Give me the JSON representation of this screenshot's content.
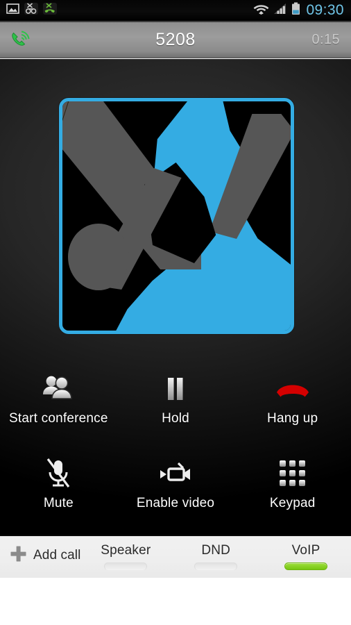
{
  "status_bar": {
    "left_icons": [
      {
        "name": "screenshot-image-icon",
        "label": "Screenshot saved"
      },
      {
        "name": "voicemail-unavailable-icon",
        "label": "Voicemail"
      },
      {
        "name": "missed-call-icon",
        "label": "Missed call"
      }
    ],
    "right_icons": [
      {
        "name": "wifi-icon",
        "label": "Wi-Fi"
      },
      {
        "name": "cellular-signal-icon",
        "label": "Signal"
      },
      {
        "name": "battery-icon",
        "label": "Battery"
      }
    ],
    "clock": "09:30",
    "clock_color": "#6fc5e8"
  },
  "title_bar": {
    "call_state_icon": "active-call-icon",
    "number": "5208",
    "duration": "0:15"
  },
  "avatar": {
    "name": "contact-photo",
    "accent_color": "#34ACE3",
    "border_color": "#34ACE3"
  },
  "controls": {
    "rows": [
      [
        {
          "icon": "conference-people-icon",
          "label": "Start conference",
          "name": "start-conference-button"
        },
        {
          "icon": "pause-icon",
          "label": "Hold",
          "name": "hold-button"
        },
        {
          "icon": "hang-up-handset-icon",
          "label": "Hang up",
          "name": "hang-up-button"
        }
      ],
      [
        {
          "icon": "microphone-muted-icon",
          "label": "Mute",
          "name": "mute-button"
        },
        {
          "icon": "video-camera-icon",
          "label": "Enable video",
          "name": "enable-video-button"
        },
        {
          "icon": "keypad-grid-icon",
          "label": "Keypad",
          "name": "keypad-button"
        }
      ]
    ],
    "hang_up_color": "#d40000"
  },
  "bottom_bar": {
    "add_call": {
      "icon": "plus-icon",
      "label": "Add call"
    },
    "toggles": [
      {
        "label": "Speaker",
        "state": "off"
      },
      {
        "label": "DND",
        "state": "off"
      },
      {
        "label": "VoIP",
        "state": "on"
      }
    ],
    "active_color": "#86d21a"
  }
}
